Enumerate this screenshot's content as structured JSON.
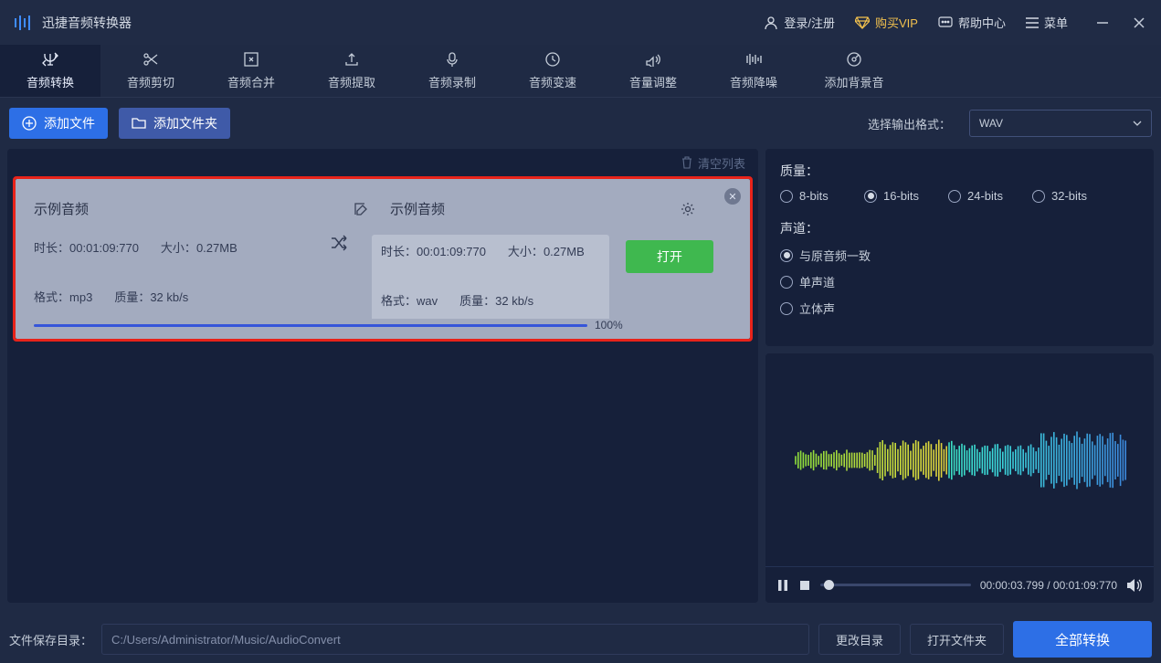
{
  "header": {
    "app_title": "迅捷音频转换器",
    "login": "登录/注册",
    "vip": "购买VIP",
    "help": "帮助中心",
    "menu": "菜单"
  },
  "toolbar": [
    {
      "label": "音频转换",
      "active": true
    },
    {
      "label": "音频剪切",
      "active": false
    },
    {
      "label": "音频合并",
      "active": false
    },
    {
      "label": "音频提取",
      "active": false
    },
    {
      "label": "音频录制",
      "active": false
    },
    {
      "label": "音频变速",
      "active": false
    },
    {
      "label": "音量调整",
      "active": false
    },
    {
      "label": "音频降噪",
      "active": false
    },
    {
      "label": "添加背景音",
      "active": false
    }
  ],
  "actions": {
    "add_file": "添加文件",
    "add_folder": "添加文件夹",
    "output_format_label": "选择输出格式：",
    "output_format_value": "WAV"
  },
  "list": {
    "clear_label": "清空列表",
    "item": {
      "src_title": "示例音频",
      "dst_title": "示例音频",
      "src_duration_label": "时长：",
      "src_duration": "00:01:09:770",
      "src_size_label": "大小：",
      "src_size": "0.27MB",
      "src_format_label": "格式：",
      "src_format": "mp3",
      "src_quality_label": "质量：",
      "src_quality": "32 kb/s",
      "dst_duration_label": "时长：",
      "dst_duration": "00:01:09:770",
      "dst_size_label": "大小：",
      "dst_size": "0.27MB",
      "dst_format_label": "格式：",
      "dst_format": "wav",
      "dst_quality_label": "质量：",
      "dst_quality": "32 kb/s",
      "open_label": "打开",
      "progress_pct": "100%"
    }
  },
  "settings": {
    "quality": {
      "title": "质量：",
      "options": [
        "8-bits",
        "16-bits",
        "24-bits",
        "32-bits"
      ],
      "selected": "16-bits"
    },
    "channel": {
      "title": "声道：",
      "options": [
        "与原音频一致",
        "单声道",
        "立体声"
      ],
      "selected": "与原音频一致"
    }
  },
  "player": {
    "current": "00:00:03.799",
    "total": "00:01:09:770"
  },
  "footer": {
    "save_label": "文件保存目录：",
    "save_path": "C:/Users/Administrator/Music/AudioConvert",
    "change_dir": "更改目录",
    "open_folder": "打开文件夹",
    "convert_all": "全部转换"
  }
}
